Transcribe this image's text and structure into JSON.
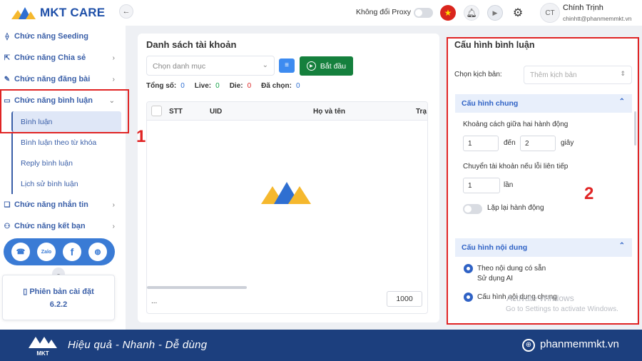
{
  "brand": {
    "name": "MKT CARE"
  },
  "sidebar": {
    "items": [
      {
        "label": "Chức năng Seeding",
        "icon": "share-nodes-icon",
        "expanded": false
      },
      {
        "label": "Chức năng Chia sẻ",
        "icon": "share-box-icon",
        "expanded": false
      },
      {
        "label": "Chức năng đăng bài",
        "icon": "edit-post-icon",
        "expanded": false
      },
      {
        "label": "Chức năng bình luận",
        "icon": "comment-square-icon",
        "expanded": true
      },
      {
        "label": "Chức năng nhắn tin",
        "icon": "chat-bubbles-icon",
        "expanded": false
      },
      {
        "label": "Chức năng kết bạn",
        "icon": "add-friend-icon",
        "expanded": false
      }
    ],
    "comment_subitems": [
      {
        "label": "Bình luận",
        "active": true
      },
      {
        "label": "Bình luận theo từ khóa",
        "active": false
      },
      {
        "label": "Reply bình luận",
        "active": false
      },
      {
        "label": "Lịch sử bình luận",
        "active": false
      }
    ],
    "social": [
      "support-headset-icon",
      "zalo-icon",
      "facebook-icon",
      "globe-icon"
    ],
    "social_labels": {
      "zalo": "Zalo",
      "facebook": "f"
    },
    "version_label": "Phiên bản cài đặt",
    "version_number": "6.2.2"
  },
  "topbar": {
    "proxy_label": "Không đổi Proxy",
    "proxy_enabled": false,
    "avatar_initials": "CT",
    "user_name": "Chính Trịnh",
    "user_email": "chinhtt@phanmemmkt.vn"
  },
  "accounts": {
    "title": "Danh sách tài khoản",
    "category_placeholder": "Chọn danh mục",
    "start_label": "Bắt đầu",
    "stats": [
      {
        "label": "Tổng số:",
        "value": "0",
        "color": "#2f6fd1"
      },
      {
        "label": "Live:",
        "value": "0",
        "color": "#16a34a"
      },
      {
        "label": "Die:",
        "value": "0",
        "color": "#dc2626"
      },
      {
        "label": "Đã chọn:",
        "value": "0",
        "color": "#2f6fd1"
      }
    ],
    "columns": [
      "STT",
      "UID",
      "Họ và tên",
      "Trạ"
    ],
    "footer_text": "...",
    "page_size": "1000"
  },
  "config": {
    "title": "Cấu hình bình luận",
    "scenario_label": "Chọn kịch bản:",
    "scenario_placeholder": "Thêm kịch bản",
    "general": {
      "header": "Cấu hình chung",
      "delay_label": "Khoảng cách giữa hai hành động",
      "delay_from": "1",
      "delay_to_label": "đến",
      "delay_to": "2",
      "delay_unit": "giây",
      "switch_label": "Chuyển tài khoản nếu lỗi liên tiếp",
      "switch_value": "1",
      "switch_unit": "lần",
      "repeat_label": "Lặp lại hành động",
      "repeat_enabled": false
    },
    "content": {
      "header": "Cấu hình nội dung",
      "opt1": "Theo nội dung có sẵn",
      "opt1_sub": "Sử dụng AI",
      "opt2": "Cấu hình nội dung chung"
    }
  },
  "annotations": {
    "one": "1",
    "two": "2"
  },
  "watermark": {
    "line1": "Activate Windows",
    "line2": "Go to Settings to activate Windows."
  },
  "footer": {
    "slogan": "Hiệu quả - Nhanh - Dễ dùng",
    "website": "phanmemmkt.vn",
    "logo_text": "MKT"
  },
  "colors": {
    "primary": "#3a5fa8",
    "accent": "#2f62c5",
    "start": "#15803d",
    "annotation": "#e02424",
    "footer_bg": "#1c3f7e"
  }
}
